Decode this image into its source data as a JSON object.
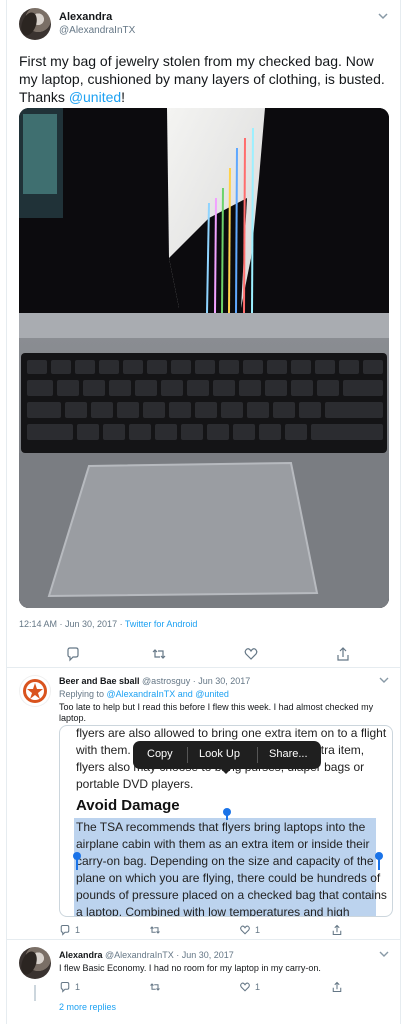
{
  "main_tweet": {
    "name": "Alexandra",
    "handle": "@AlexandraInTX",
    "text_before": "First my bag of jewelry stolen from my checked bag. Now my laptop, cushioned by many layers of clothing, is busted. Thanks ",
    "mention": "@united",
    "text_after": "!",
    "timestamp": "12:14 AM · Jun 30, 2017 · ",
    "via": "Twitter for Android",
    "photo_icon": "broken-laptop-photo"
  },
  "reply1": {
    "name": "Beer and Bae sball",
    "handle_date": " @astrosguy · Jun 30, 2017",
    "replying_prefix": "Replying to ",
    "replying_to": "@AlexandraInTX and @united",
    "text": "Too late to help but I read this before I flew this week. I had almost checked my laptop.",
    "embed": {
      "lines_top": [
        "flyers are also allowed to bring one extra item on to a flight",
        "with them. While a laptop may serve as the extra item,",
        "flyers also may choose to bring purses, diaper bags or",
        "portable DVD players."
      ],
      "heading": "Avoid Damage",
      "selected_lines": [
        "The TSA recommends that flyers bring laptops into the",
        "airplane cabin with them as an extra item or inside their",
        "carry-on bag. Depending on the size and capacity of the",
        "plane on which you are flying, there could be hundreds of",
        "pounds of pressure placed on a checked bag that contains",
        "a laptop. Combined with low temperatures and high"
      ],
      "menu": {
        "copy": "Copy",
        "look_up": "Look Up",
        "share": "Share..."
      }
    },
    "reply_count": "1",
    "like_count": "1"
  },
  "reply2": {
    "name": "Alexandra",
    "handle_date": " @AlexandraInTX · Jun 30, 2017",
    "text": "I flew Basic Economy. I had no room for my laptop in my carry-on.",
    "reply_count": "1",
    "like_count": "1",
    "more_replies": "2 more replies"
  },
  "colors": {
    "link": "#1da1f2",
    "secondary_text": "#657786",
    "border": "#e6ecf0",
    "selection": "#bcd3ee",
    "handle": "#1a73e8"
  }
}
